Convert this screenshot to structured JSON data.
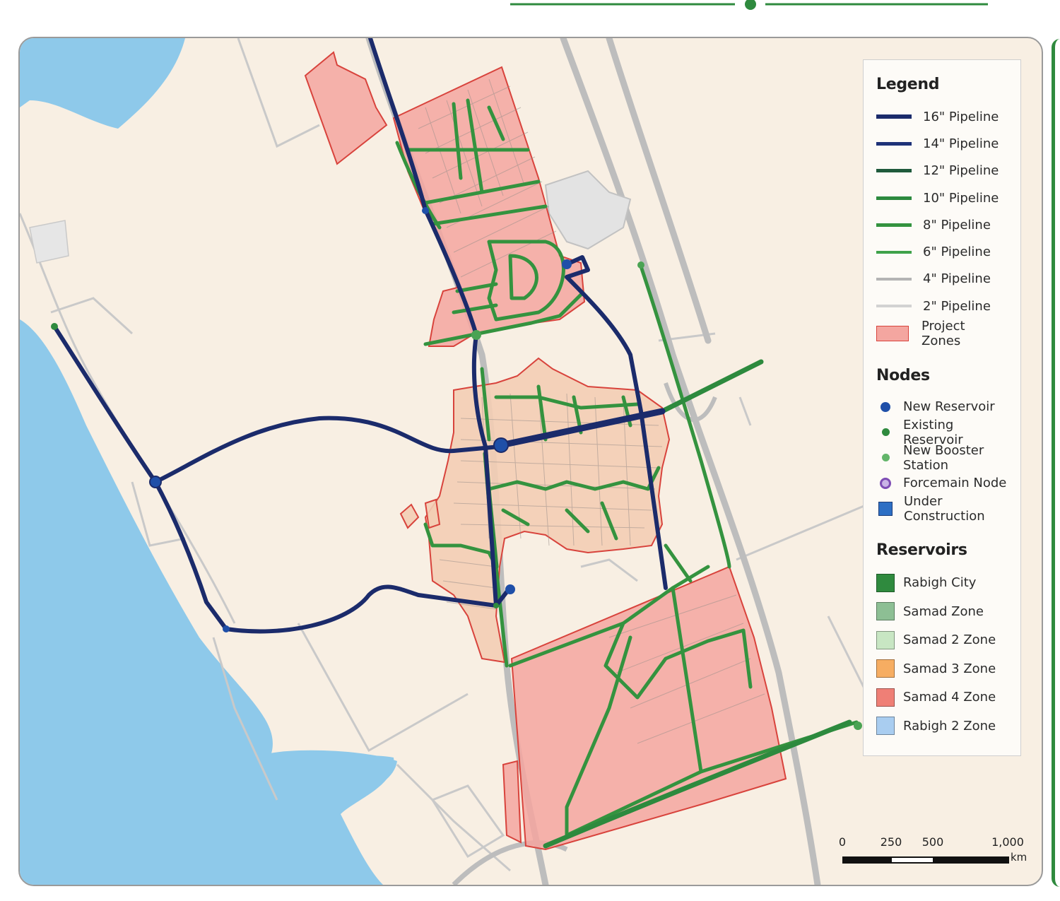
{
  "colors": {
    "water": "#8ec9ea",
    "land": "#f8efe3",
    "zone_fill": "#f4a6a0",
    "zone_stroke": "#d8433c",
    "urban_fill": "#f3cdb4",
    "pipe_16": "#1b2b6b",
    "pipe_14": "#1e3278",
    "pipe_12": "#1f5a3c",
    "pipe_10": "#2d8a3e",
    "pipe_8": "#34933f",
    "pipe_6": "#3fa24a",
    "pipe_4": "#b4b4b4",
    "pipe_2": "#cfcfcf",
    "road": "#c8c8c8"
  },
  "legend": {
    "title": "Legend",
    "pipelines": [
      {
        "label": "16\" Pipeline",
        "color": "#1b2b6b"
      },
      {
        "label": "14\" Pipeline",
        "color": "#1e3278"
      },
      {
        "label": "12\" Pipeline",
        "color": "#1f5a3c"
      },
      {
        "label": "10\" Pipeline",
        "color": "#2d8a3e"
      },
      {
        "label": "8\" Pipeline",
        "color": "#34933f"
      },
      {
        "label": "6\" Pipeline",
        "color": "#3fa24a"
      },
      {
        "label": "4\" Pipeline",
        "color": "#b4b4b4"
      },
      {
        "label": "2\" Pipeline",
        "color": "#d2d2d2"
      }
    ],
    "project_zones_label": "Project Zones",
    "nodes_title": "Nodes",
    "nodes": [
      {
        "label": "New Reservoir",
        "color": "#1f4fa8",
        "shape": "circle"
      },
      {
        "label": "Existing Reservoir",
        "color": "#2f8a3e",
        "shape": "circle"
      },
      {
        "label": "New Booster Station",
        "color": "#63b56a",
        "shape": "circle"
      },
      {
        "label": "Forcemain Node",
        "color": "#7e4db5",
        "shape": "ring"
      },
      {
        "label": "Under Construction",
        "color": "#2d6fc4",
        "shape": "square"
      }
    ],
    "reservoirs_title": "Reservoirs",
    "reservoirs": [
      {
        "label": "Rabigh City",
        "color": "#2f8a3e"
      },
      {
        "label": "Samad Zone",
        "color": "#8dbf94"
      },
      {
        "label": "Samad 2 Zone",
        "color": "#c8e6c3"
      },
      {
        "label": "Samad 3 Zone",
        "color": "#f6ad62"
      },
      {
        "label": "Samad 4 Zone",
        "color": "#ef7f76"
      },
      {
        "label": "Rabigh 2 Zone",
        "color": "#a9cdf0"
      }
    ]
  },
  "scale_bar": {
    "ticks": [
      "0",
      "250",
      "500",
      "1,000"
    ],
    "unit": "km"
  }
}
